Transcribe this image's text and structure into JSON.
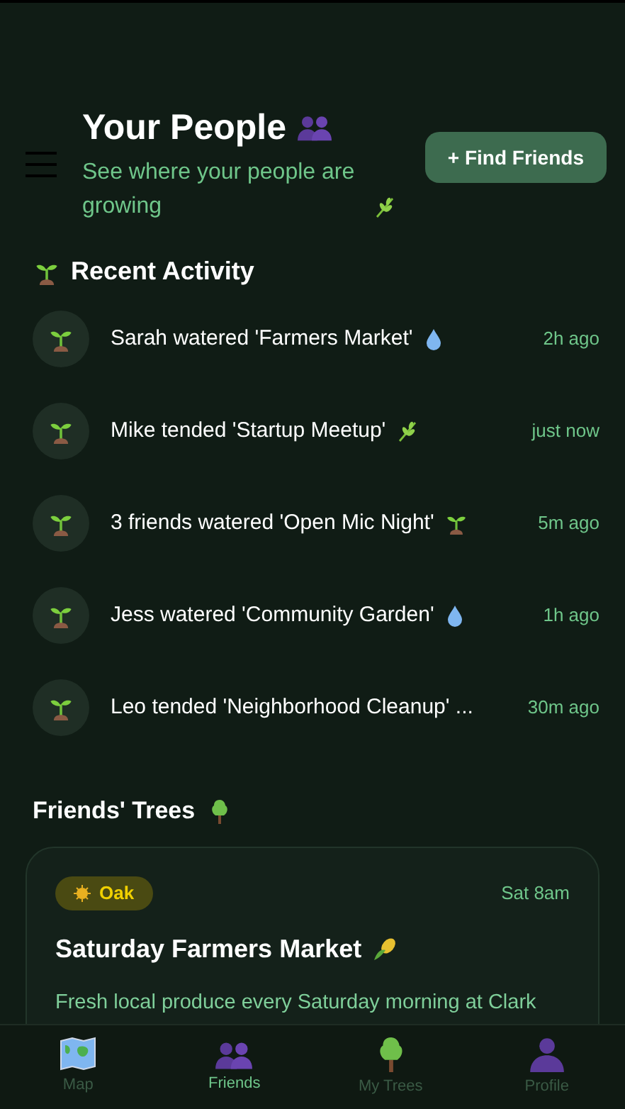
{
  "header": {
    "title": "Your People",
    "subtitle": "See where your people are growing",
    "button": "+ Find Friends"
  },
  "recent_activity": {
    "title": "Recent Activity",
    "items": [
      {
        "text": "Sarah watered 'Farmers Market'",
        "kind": "drop",
        "time": "2h ago"
      },
      {
        "text": "Mike tended 'Startup Meetup'",
        "kind": "herb",
        "time": "just now"
      },
      {
        "text": "3 friends watered 'Open Mic Night'",
        "kind": "sprout",
        "time": "5m ago"
      },
      {
        "text": "Jess watered 'Community Garden'",
        "kind": "drop",
        "time": "1h ago"
      },
      {
        "text": "Leo tended 'Neighborhood Cleanup' ...",
        "time": "30m ago"
      }
    ]
  },
  "friends_trees": {
    "title": "Friends' Trees",
    "cards": [
      {
        "badge": "Oak",
        "time": "Sat 8am",
        "title": "Saturday Farmers Market",
        "description": "Fresh local produce every Saturday morning at Clark"
      }
    ]
  },
  "nav": [
    {
      "label": "Map",
      "selected": false
    },
    {
      "label": "Friends",
      "selected": true
    },
    {
      "label": "My Trees",
      "selected": false
    },
    {
      "label": "Profile",
      "selected": false
    }
  ]
}
